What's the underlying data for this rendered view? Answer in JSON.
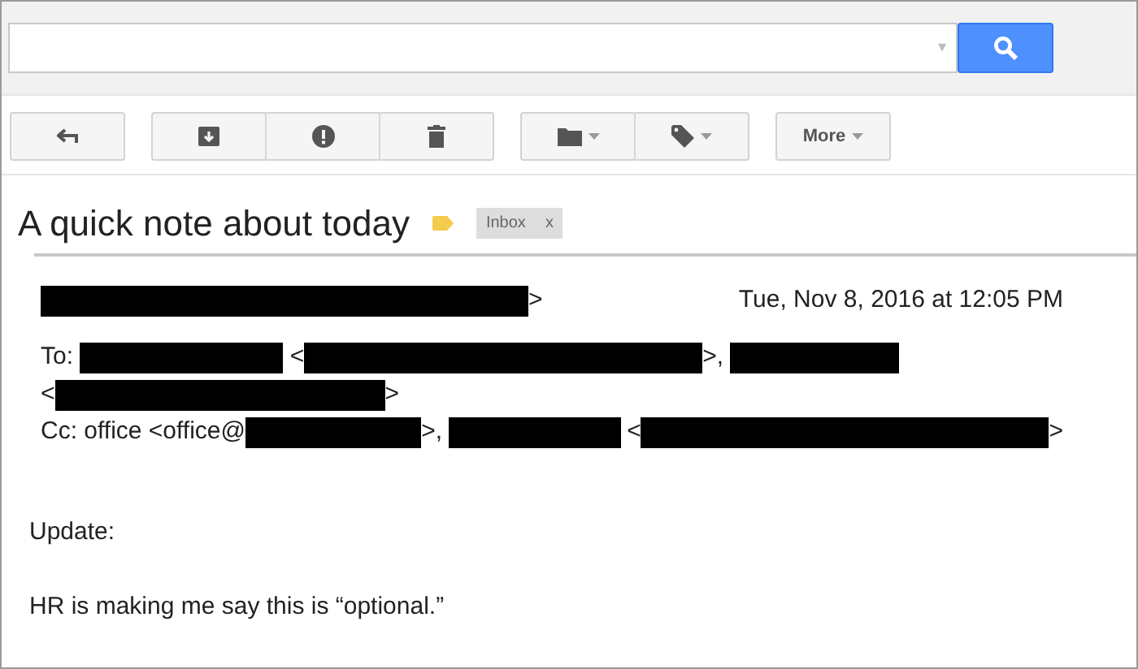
{
  "search": {
    "dropdown_caret": "▾"
  },
  "toolbar": {
    "groups": [
      [
        {
          "kind": "reply"
        }
      ],
      [
        {
          "kind": "archive"
        },
        {
          "kind": "spam"
        },
        {
          "kind": "delete"
        }
      ],
      [
        {
          "kind": "move"
        },
        {
          "kind": "labels"
        }
      ],
      [
        {
          "kind": "more",
          "label": "More"
        }
      ]
    ]
  },
  "message": {
    "subject": "A quick note about today",
    "important": true,
    "labels": [
      {
        "text": "Inbox",
        "remove": "x"
      }
    ],
    "date": "Tue, Nov 8, 2016 at 12:05 PM",
    "header_lines": [
      {
        "segments": [
          {
            "kind": "redaction"
          },
          {
            "kind": "text",
            "text": ">"
          }
        ]
      },
      {
        "segments": [
          {
            "kind": "text",
            "text": "To: "
          },
          {
            "kind": "redaction"
          },
          {
            "kind": "text",
            "text": " <"
          },
          {
            "kind": "redaction"
          },
          {
            "kind": "text",
            "text": ">, "
          },
          {
            "kind": "redaction"
          }
        ]
      },
      {
        "segments": [
          {
            "kind": "text",
            "text": "<"
          },
          {
            "kind": "redaction"
          },
          {
            "kind": "text",
            "text": ">"
          }
        ]
      },
      {
        "segments": [
          {
            "kind": "text",
            "text": "Cc: office <office@"
          },
          {
            "kind": "redaction"
          },
          {
            "kind": "text",
            "text": ">, "
          },
          {
            "kind": "redaction"
          },
          {
            "kind": "text",
            "text": " <"
          },
          {
            "kind": "redaction"
          },
          {
            "kind": "text",
            "text": ">"
          }
        ]
      }
    ],
    "body": [
      "Update:",
      "HR is making me say this is “optional.”"
    ]
  }
}
